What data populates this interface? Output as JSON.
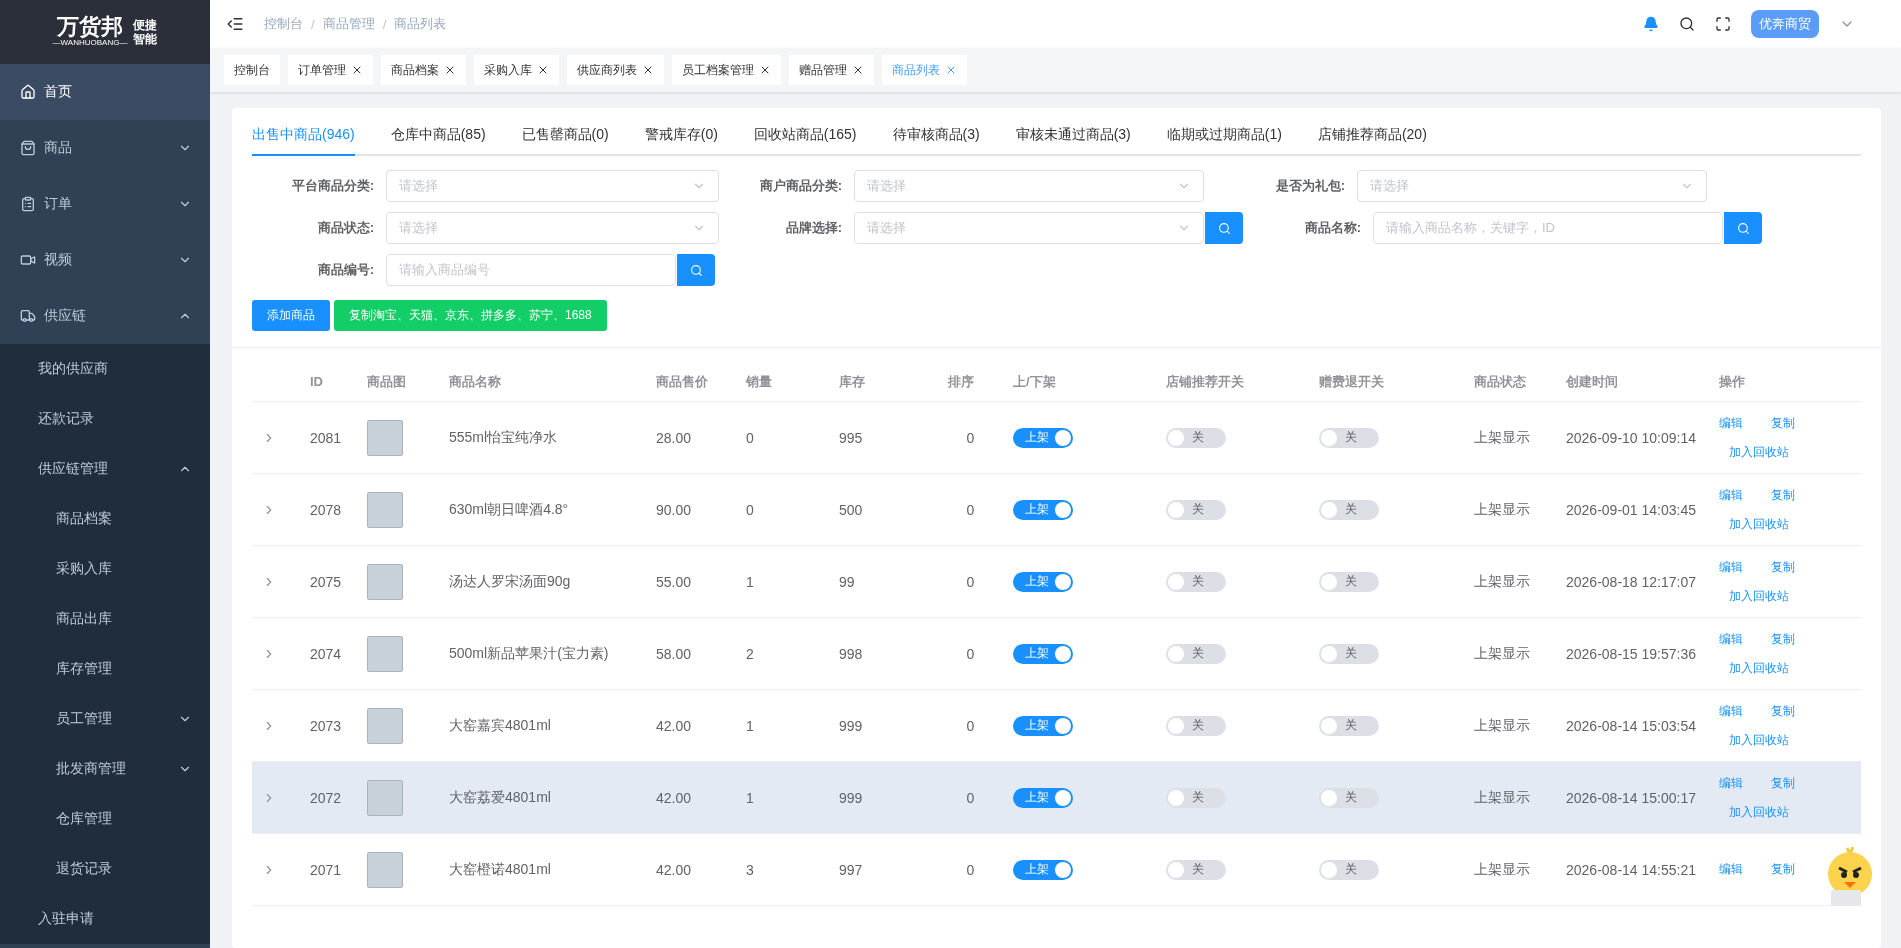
{
  "logo": {
    "name": "万货邦",
    "sub": "—WANHUOBANG—",
    "tagline_1": "便捷",
    "tagline_2": "智能"
  },
  "sidebar": {
    "items": [
      {
        "label": "首页",
        "selected": true
      },
      {
        "label": "商品",
        "selected": false,
        "expanded": false
      },
      {
        "label": "订单",
        "selected": false,
        "expanded": false
      },
      {
        "label": "视频",
        "selected": false,
        "expanded": false
      },
      {
        "label": "供应链",
        "selected": false,
        "expanded": true,
        "children": [
          {
            "label": "我的供应商",
            "selected": false
          },
          {
            "label": "还款记录",
            "selected": false
          },
          {
            "label": "供应链管理",
            "selected": false,
            "expanded": true,
            "children": [
              {
                "label": "商品档案",
                "selected": false
              },
              {
                "label": "采购入库",
                "selected": false
              },
              {
                "label": "商品出库",
                "selected": false
              },
              {
                "label": "库存管理",
                "selected": false
              },
              {
                "label": "员工管理",
                "selected": false,
                "expanded": false
              },
              {
                "label": "批发商管理",
                "selected": false,
                "expanded": false
              },
              {
                "label": "仓库管理",
                "selected": false
              },
              {
                "label": "退货记录",
                "selected": false
              }
            ]
          },
          {
            "label": "入驻申请",
            "selected": false
          }
        ]
      }
    ]
  },
  "breadcrumb": [
    {
      "label": "控制台"
    },
    {
      "separator": "/",
      "label": "商品管理"
    },
    {
      "separator": "/",
      "label": "商品列表"
    }
  ],
  "user": {
    "name": "优奔商贸"
  },
  "page_tabs": [
    {
      "label": "控制台",
      "closable": false,
      "selected": false
    },
    {
      "label": "订单管理",
      "closable": true,
      "selected": false
    },
    {
      "label": "商品档案",
      "closable": true,
      "selected": false
    },
    {
      "label": "采购入库",
      "closable": true,
      "selected": false
    },
    {
      "label": "供应商列表",
      "closable": true,
      "selected": false
    },
    {
      "label": "员工档案管理",
      "closable": true,
      "selected": false
    },
    {
      "label": "赠品管理",
      "closable": true,
      "selected": false
    },
    {
      "label": "商品列表",
      "closable": true,
      "selected": true
    }
  ],
  "product_tabs": [
    {
      "label": "出售中商品(946)",
      "selected": true
    },
    {
      "label": "仓库中商品(85)",
      "selected": false
    },
    {
      "label": "已售罄商品(0)",
      "selected": false
    },
    {
      "label": "警戒库存(0)",
      "selected": false
    },
    {
      "label": "回收站商品(165)",
      "selected": false
    },
    {
      "label": "待审核商品(3)",
      "selected": false
    },
    {
      "label": "审核未通过商品(3)",
      "selected": false
    },
    {
      "label": "临期或过期商品(1)",
      "selected": false
    },
    {
      "label": "店铺推荐商品(20)",
      "selected": false
    }
  ],
  "filters": [
    [
      {
        "label": "平台商品分类:",
        "kind": "select",
        "placeholder": "请选择"
      },
      {
        "label": "商户商品分类:",
        "kind": "select",
        "placeholder": "请选择"
      },
      {
        "label": "是否为礼包:",
        "kind": "select",
        "placeholder": "请选择"
      }
    ],
    [
      {
        "label": "商品状态:",
        "kind": "select",
        "placeholder": "请选择"
      },
      {
        "label": "品牌选择:",
        "kind": "select_search",
        "placeholder": "请选择"
      },
      {
        "label": "商品名称:",
        "kind": "search",
        "placeholder": "请输入商品名称，关键字，ID"
      }
    ],
    [
      {
        "label": "商品编号:",
        "kind": "search",
        "placeholder": "请输入商品编号"
      }
    ]
  ],
  "actions": [
    {
      "label": "添加商品",
      "kind": "primary"
    },
    {
      "label": "复制淘宝、天猫、京东、拼多多、苏宁、1688",
      "kind": "success"
    }
  ],
  "table": {
    "columns": [
      "ID",
      "商品图",
      "商品名称",
      "商品售价",
      "销量",
      "库存",
      "排序",
      "上/下架",
      "店铺推荐开关",
      "赠费退开关",
      "商品状态",
      "创建时间",
      "操作"
    ],
    "rows": [
      {
        "id": "2081",
        "name": "555ml怡宝纯净水",
        "price": "28.00",
        "sales": "0",
        "stock": "995",
        "sort": "0",
        "shelf": {
          "label": "上架",
          "on": true
        },
        "recommend": {
          "label": "关",
          "on": false
        },
        "refund": {
          "label": "关",
          "on": false
        },
        "status": "上架显示",
        "created": "2026-09-10 10:09:14",
        "highlighted": false,
        "ops": [
          "编辑",
          "复制",
          "加入回收站"
        ]
      },
      {
        "id": "2078",
        "name": "630ml朝日啤酒4.8°",
        "price": "90.00",
        "sales": "0",
        "stock": "500",
        "sort": "0",
        "shelf": {
          "label": "上架",
          "on": true
        },
        "recommend": {
          "label": "关",
          "on": false
        },
        "refund": {
          "label": "关",
          "on": false
        },
        "status": "上架显示",
        "created": "2026-09-01 14:03:45",
        "highlighted": false,
        "ops": [
          "编辑",
          "复制",
          "加入回收站"
        ]
      },
      {
        "id": "2075",
        "name": "汤达人罗宋汤面90g",
        "price": "55.00",
        "sales": "1",
        "stock": "99",
        "sort": "0",
        "shelf": {
          "label": "上架",
          "on": true
        },
        "recommend": {
          "label": "关",
          "on": false
        },
        "refund": {
          "label": "关",
          "on": false
        },
        "status": "上架显示",
        "created": "2026-08-18 12:17:07",
        "highlighted": false,
        "ops": [
          "编辑",
          "复制",
          "加入回收站"
        ]
      },
      {
        "id": "2074",
        "name": "500ml新品苹果汁(宝力素)",
        "price": "58.00",
        "sales": "2",
        "stock": "998",
        "sort": "0",
        "shelf": {
          "label": "上架",
          "on": true
        },
        "recommend": {
          "label": "关",
          "on": false
        },
        "refund": {
          "label": "关",
          "on": false
        },
        "status": "上架显示",
        "created": "2026-08-15 19:57:36",
        "highlighted": false,
        "ops": [
          "编辑",
          "复制",
          "加入回收站"
        ]
      },
      {
        "id": "2073",
        "name": "大窑嘉宾4801ml",
        "price": "42.00",
        "sales": "1",
        "stock": "999",
        "sort": "0",
        "shelf": {
          "label": "上架",
          "on": true
        },
        "recommend": {
          "label": "关",
          "on": false
        },
        "refund": {
          "label": "关",
          "on": false
        },
        "status": "上架显示",
        "created": "2026-08-14 15:03:54",
        "highlighted": false,
        "ops": [
          "编辑",
          "复制",
          "加入回收站"
        ]
      },
      {
        "id": "2072",
        "name": "大窑荔爱4801ml",
        "price": "42.00",
        "sales": "1",
        "stock": "999",
        "sort": "0",
        "shelf": {
          "label": "上架",
          "on": true
        },
        "recommend": {
          "label": "关",
          "on": false
        },
        "refund": {
          "label": "关",
          "on": false
        },
        "status": "上架显示",
        "created": "2026-08-14 15:00:17",
        "highlighted": true,
        "ops": [
          "编辑",
          "复制",
          "加入回收站"
        ]
      },
      {
        "id": "2071",
        "name": "大窑橙诺4801ml",
        "price": "42.00",
        "sales": "3",
        "stock": "997",
        "sort": "0",
        "shelf": {
          "label": "上架",
          "on": true
        },
        "recommend": {
          "label": "关",
          "on": false
        },
        "refund": {
          "label": "关",
          "on": false
        },
        "status": "上架显示",
        "created": "2026-08-14 14:55:21",
        "highlighted": false,
        "ops": [
          "编辑",
          "复制"
        ]
      }
    ]
  }
}
